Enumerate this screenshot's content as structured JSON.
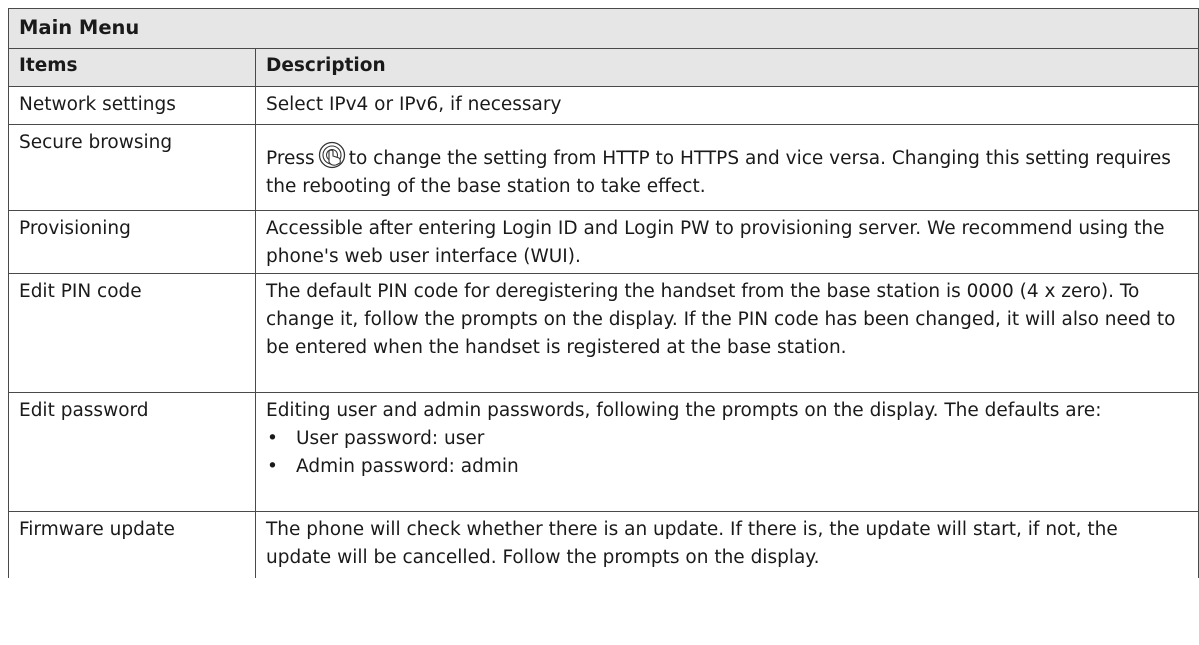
{
  "table": {
    "title": "Main Menu",
    "headers": {
      "items": "Items",
      "description": "Description"
    },
    "rows": [
      {
        "item": "Network settings",
        "description": "Select IPv4 or IPv6, if necessary"
      },
      {
        "item": "Secure browsing",
        "description_before_icon": "Press",
        "icon": "touch-press-icon",
        "description_after_icon": "to change the setting from HTTP to HTTPS and vice versa.  Changing this setting requires the rebooting of the base station to take effect."
      },
      {
        "item": "Provisioning",
        "description": "Accessible after entering Login ID and Login PW to provisioning server.  We recommend using the phone's web user interface (WUI)."
      },
      {
        "item": "Edit PIN code",
        "description": "The default PIN code for deregistering the handset from the base station is 0000 (4 x zero).  To change it, follow the prompts on the display.  If the PIN code has been changed, it will also need to be entered when the handset is registered at the base station."
      },
      {
        "item": "Edit password",
        "description": "Editing user and admin passwords, following the prompts on the display.  The defaults are:",
        "bullets": [
          "User password:  user",
          "Admin password:  admin"
        ]
      },
      {
        "item": "Firmware update",
        "description": "The phone will check whether there is an update.  If there is, the update will start, if not, the update will be cancelled.  Follow the prompts on the display."
      }
    ]
  }
}
